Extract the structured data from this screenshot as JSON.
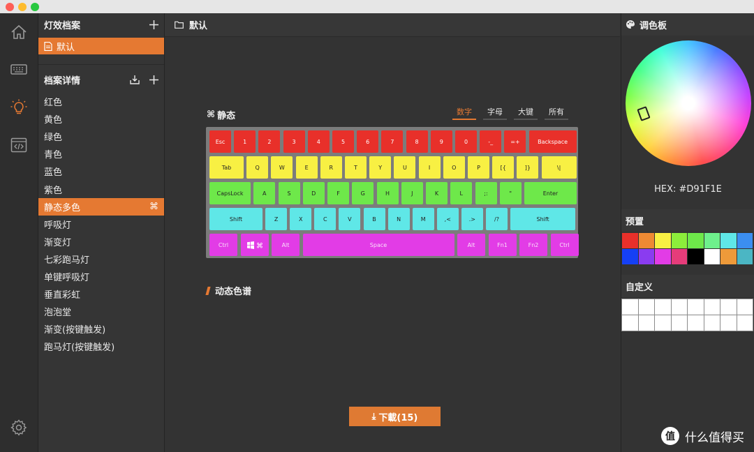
{
  "window": {
    "controls": [
      "close",
      "minimize",
      "maximize"
    ]
  },
  "rail": {
    "items": [
      {
        "icon": "home-icon"
      },
      {
        "icon": "keyboard-icon"
      },
      {
        "icon": "lightbulb-icon",
        "active": true
      },
      {
        "icon": "code-icon"
      },
      {
        "icon": "gear-icon"
      }
    ],
    "active_color": "#e57932"
  },
  "profiles": {
    "title": "灯效档案",
    "items": [
      {
        "label": "默认",
        "active": true
      }
    ]
  },
  "details": {
    "title": "档案详情",
    "items": [
      "红色",
      "黄色",
      "绿色",
      "青色",
      "蓝色",
      "紫色",
      "静态多色",
      "呼吸灯",
      "渐变灯",
      "七彩跑马灯",
      "单键呼吸灯",
      "垂直彩虹",
      "泡泡堂",
      "渐变(按键触发)",
      "跑马灯(按键触发)"
    ],
    "active_index": 6
  },
  "main": {
    "header_title": "默认",
    "section_title": "静态",
    "tabs": [
      "数字",
      "字母",
      "大键",
      "所有"
    ],
    "active_tab": 0,
    "dynamic_title": "动态色谱",
    "download_label": "下載(15)"
  },
  "keyboard": {
    "rows": [
      [
        "Esc",
        "1",
        "2",
        "3",
        "4",
        "5",
        "6",
        "7",
        "8",
        "9",
        "0",
        "-_",
        "=+",
        "Backspace"
      ],
      [
        "Tab",
        "Q",
        "W",
        "E",
        "R",
        "T",
        "Y",
        "U",
        "I",
        "O",
        "P",
        "[{",
        "]}",
        "\\|"
      ],
      [
        "CapsLock",
        "A",
        "S",
        "D",
        "F",
        "G",
        "H",
        "J",
        "K",
        "L",
        ";:",
        "\"",
        "Enter"
      ],
      [
        "Shift",
        "Z",
        "X",
        "C",
        "V",
        "B",
        "N",
        "M",
        ",<",
        ".>",
        "/?",
        "Shift"
      ],
      [
        "Ctrl",
        "Win",
        "Alt",
        "Space",
        "Alt",
        "Fn1",
        "Fn2",
        "Ctrl"
      ]
    ],
    "row_colors": [
      "#e8302a",
      "#f8f043",
      "#6ee84a",
      "#5fe7e7",
      "#e23ce6"
    ]
  },
  "palette": {
    "title": "调色板",
    "hex_text": "HEX: #D91F1E",
    "preset_title": "预置",
    "preset_colors": [
      "#e8302a",
      "#ee8a33",
      "#f8f043",
      "#8ced3b",
      "#6ee84a",
      "#6ef08c",
      "#5fe7e7",
      "#3b8ef0",
      "#1540f5",
      "#8a3cf0",
      "#e23ce6",
      "#e63c7a",
      "#000000",
      "#ffffff",
      "#ee9a3a",
      "#4bb6c4"
    ],
    "custom_title": "自定义",
    "custom_count": 16
  },
  "watermark": {
    "text": "什么值得买",
    "logo": "值"
  }
}
